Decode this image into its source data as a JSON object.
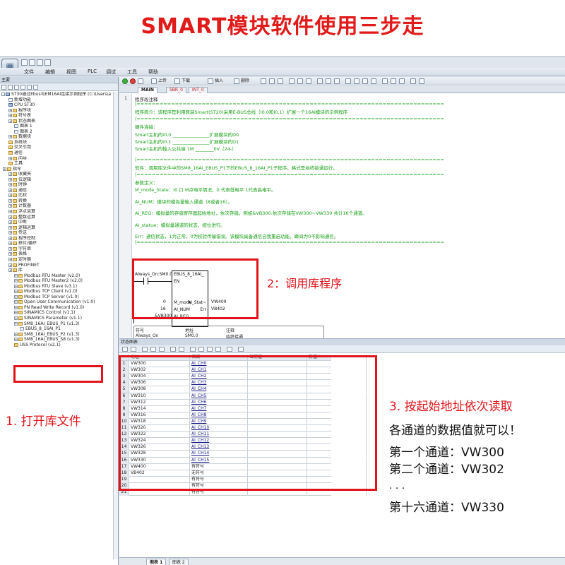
{
  "headline": "SMART模块软件使用三步走",
  "menu": {
    "items": [
      "文件",
      "编辑",
      "视图",
      "PLC",
      "调试",
      "工具",
      "帮助"
    ]
  },
  "toolbar": {
    "upload": "上传",
    "download": "下载",
    "insert": "插入",
    "delete": "删除"
  },
  "tabs": [
    "MAIN",
    "SBR_0",
    "INT_0"
  ],
  "project": {
    "panel_title": "主要",
    "root": "ST30通过Ebus与EM16AI连接示例程序 (C:\\Users\\a",
    "items": [
      "新增功能",
      "CPU ST30",
      "程序块",
      "符号表",
      "状态图表",
      "图表 1",
      "图表 2",
      "数据块",
      "系统块",
      "交叉引用",
      "通信",
      "向导",
      "工具",
      "指令",
      "收藏夹",
      "位逻辑",
      "时钟",
      "通信",
      "比较",
      "转换",
      "计数器",
      "浮点运算",
      "整数运算",
      "中断",
      "逻辑运算",
      "传送",
      "程序控制",
      "移位/循环",
      "字符串",
      "表格",
      "定时器",
      "PROFINET",
      "库",
      "Modbus RTU Master (v2.0)",
      "Modbus RTU Master2 (v2.0)",
      "Modbus RTU Slave (v3.1)",
      "Modbus TCP Client (v1.0)",
      "Modbus TCP Server (v1.0)",
      "Open User Communication (v1.0)",
      "PN Read Write Record (v1.0)",
      "SINAMICS Control (v1.1)",
      "SINAMICS Parameter (v1.1)",
      "SM8_16AI_EBUS_P1 (v1.3)",
      "EBUS_8_16AI_P1",
      "SM8_16AI_EBUS_P2 (v1.3)",
      "SM8_16AI_EBUS_S8 (v1.3)",
      "USS Protocol (v2.1)"
    ]
  },
  "program_comment": {
    "title": "程序段注释",
    "lines": [
      "|================================================================================",
      "程序简介：该程序是利用原装Smart(ST20)采用E-BUS总线（I0.0和I0.1）扩展一个16AI模块的示例程序",
      "|================================================================================",
      "硬件连接：",
      "Smart主机的I0.0 ________________扩展模块的D0",
      "Smart主机的I0.1 ________________扩展模块的D1",
      "Smart主机的输入公共端 1M ________0V（24-）",
      "",
      "|================================================================================",
      "软件：调用库文件中的SM8_16AI_EBUS_P1下的EBUS_8_16AI_P1子程序。格式是始终接通运行。",
      "|================================================================================",
      "参数定义：",
      "M_mode_State：I0 口 M点电平情况，0 代表低电平 1代表高电平。",
      "",
      "AI_NUM：模块的模拟量输入通道（8或者16）。",
      "",
      "AI_REG：模拟量的存储寄存器起始地址，依次存储。例如&VB300:依次存储在VW300~VW330 共计16个通道。",
      "",
      "AI_statue：模拟量通道的状态，按位进行。",
      "",
      "Err：通信状态，1为正常。0为校验传输错误。该模块具备通信自我重启功能，瞬间为0不影响通信。",
      "|================================================================================"
    ]
  },
  "ladder": {
    "contact": "Always_On:SM0.0",
    "block": "EBUS_8_16AI_",
    "en": "EN",
    "in1_val": "0",
    "in1": "M_mode",
    "out1": "AI_Stat~",
    "out1_val": "VW400",
    "in2_val": "16",
    "in2": "AI_NUM",
    "out2": "Err",
    "out2_val": "VB402",
    "in3_val": "&VB300",
    "in3": "AI_REG"
  },
  "symtable": {
    "headers": [
      "符号",
      "地址",
      "注释"
    ],
    "row": [
      "Always_On",
      "SM0.0",
      "始终接通"
    ]
  },
  "status_chart": {
    "title": "状态图表",
    "headers": [
      "",
      "地址",
      "格式",
      "当前值",
      "新值"
    ],
    "rows": [
      [
        "1",
        "VW300",
        "AI_CH0"
      ],
      [
        "2",
        "VW302",
        "AI_CH1"
      ],
      [
        "3",
        "VW304",
        "AI_CH2"
      ],
      [
        "4",
        "VW306",
        "AI_CH3"
      ],
      [
        "5",
        "VW308",
        "AI_CH4"
      ],
      [
        "6",
        "VW310",
        "AI_CH5"
      ],
      [
        "7",
        "VW312",
        "AI_CH6"
      ],
      [
        "8",
        "VW314",
        "AI_CH7"
      ],
      [
        "9",
        "VW316",
        "AI_CH8"
      ],
      [
        "10",
        "VW318",
        "AI_CH9"
      ],
      [
        "11",
        "VW320",
        "AI_CH10"
      ],
      [
        "12",
        "VW322",
        "AI_CH11"
      ],
      [
        "13",
        "VW324",
        "AI_CH12"
      ],
      [
        "14",
        "VW326",
        "AI_CH13"
      ],
      [
        "15",
        "VW328",
        "AI_CH14"
      ],
      [
        "16",
        "VW330",
        "AI_CH15"
      ],
      [
        "17",
        "VW400",
        "有符号"
      ],
      [
        "18",
        "VB402",
        "无符号"
      ],
      [
        "19",
        "",
        "有符号"
      ],
      [
        "20",
        "",
        "有符号"
      ],
      [
        "21",
        "",
        "有符号"
      ]
    ],
    "sheet_tabs": [
      "图表 1",
      "图表 2"
    ]
  },
  "annotations": {
    "step1": "1. 打开库文件",
    "step2": "2：调用库程序",
    "step3_line1": "3. 按起始地址依次读取",
    "step3_line2": "各通道的数据值就可以！",
    "ch_first": "第一个通道：VW300",
    "ch_second": "第二个通道：VW302",
    "ellipsis": ". . .",
    "ch_last": "第十六通道：VW330"
  },
  "colors": {
    "accent_red": "#e0141a",
    "comment_green": "#18a018"
  }
}
